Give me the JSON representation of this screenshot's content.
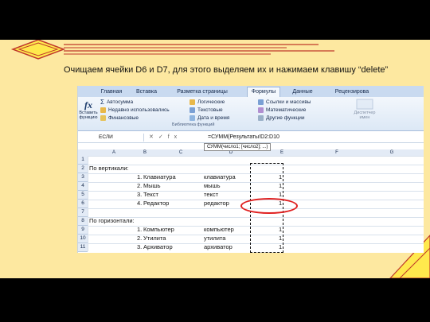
{
  "caption": "Очищаем ячейки D6 и D7, для этого выделяем их и нажимаем клавишу “delete”",
  "ribbon_tabs": [
    "Главная",
    "Вставка",
    "Разметка страницы",
    "Формулы",
    "Данные",
    "Рецензирова"
  ],
  "active_tab": "Формулы",
  "ribbon": {
    "insert_function": "Вставить функцию",
    "autosum": "Автосумма",
    "recent": "Недавно использовались",
    "financial": "Финансовые",
    "logical": "Логические",
    "text": "Текстовые",
    "datetime": "Дата и время",
    "lookup": "Ссылки и массивы",
    "math": "Математические",
    "other": "Другие функции",
    "group_label": "Библиотека функций",
    "dispatcher": "Диспетчер имен"
  },
  "formula_bar": {
    "name_box": "ЕСЛИ",
    "buttons": "✕✓fx",
    "formula": "=СУММ(Результаты!D2:D10",
    "tooltip": "СУММ(число1; [число2]; ...)"
  },
  "columns": [
    "A",
    "B",
    "C",
    "D",
    "E",
    "F",
    "G"
  ],
  "rows": [
    "1",
    "2",
    "3",
    "4",
    "5",
    "6",
    "7",
    "8",
    "9",
    "10",
    "11"
  ],
  "cells": {
    "a2": "По вертикали:",
    "b3": "1.",
    "c3": "Клавиатура",
    "d3": "клавиатура",
    "e3": "1",
    "b4": "2.",
    "c4": "Мышь",
    "d4": "мышь",
    "e4": "1",
    "b5": "3.",
    "c5": "Текст",
    "d5": "текст",
    "e5": "1",
    "b6": "4.",
    "c6": "Редактор",
    "d6": "редактор",
    "e6": "1",
    "a8": "По горизонтали:",
    "b9": "1.",
    "c9": "Компьютер",
    "d9": "компьютер",
    "e9": "1",
    "b10": "2.",
    "c10": "Утилита",
    "d10": "утилита",
    "e10": "1",
    "b11": "3.",
    "c11": "Архиватор",
    "d11": "архиватор",
    "e11": "1"
  },
  "colors": {
    "slide_bg": "#fde8a0",
    "highlight_oval": "#e02020",
    "accent_yellow": "#ffe94d",
    "deco_line": "#c0392b"
  }
}
